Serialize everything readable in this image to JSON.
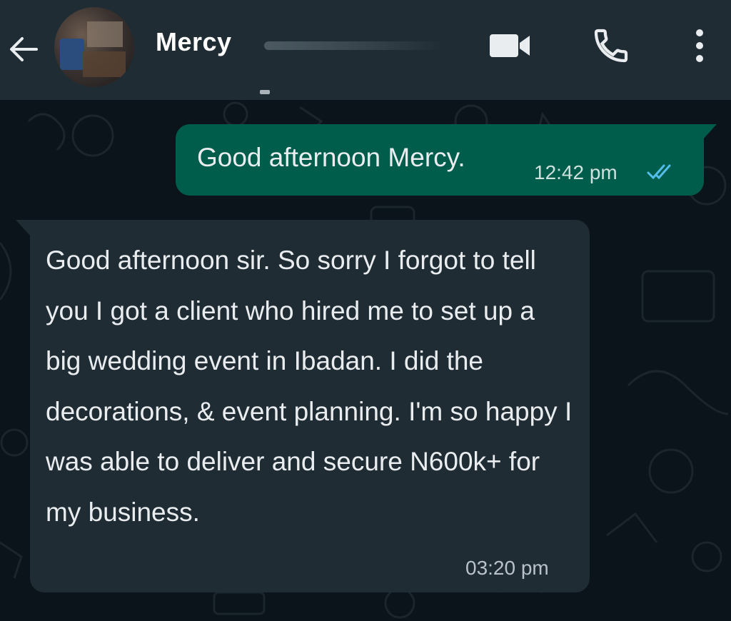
{
  "header": {
    "contact_name": "Mercy",
    "icons": {
      "back": "arrow-left-icon",
      "avatar": "contact-avatar",
      "video": "video-camera-icon",
      "call": "phone-icon",
      "menu": "more-vertical-icon"
    }
  },
  "colors": {
    "header_bg": "#1f2c34",
    "chat_bg": "#0b141a",
    "outgoing_bubble": "#005c4b",
    "incoming_bubble": "#1f2c34",
    "read_ticks": "#53bdeb"
  },
  "messages": [
    {
      "direction": "outgoing",
      "text": "Good afternoon Mercy.",
      "time": "12:42 pm",
      "status_icon": "double-check-read-icon"
    },
    {
      "direction": "incoming",
      "text": " Good afternoon sir. So sorry I forgot to tell you I got a client who hired me to set up a big wedding event in Ibadan. I did the decorations, & event planning. I'm so happy I was able to deliver and secure N600k+ for my business.",
      "time": "03:20 pm"
    }
  ]
}
